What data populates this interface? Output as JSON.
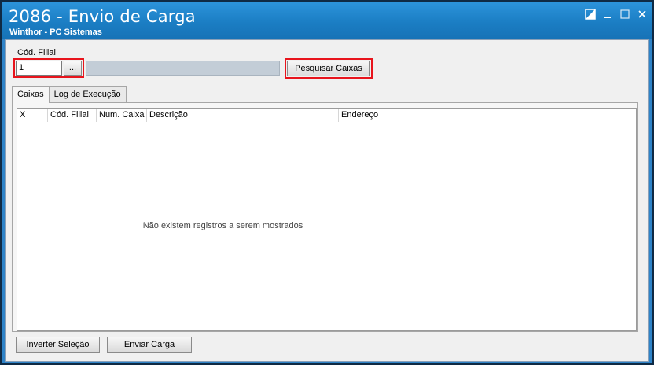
{
  "window": {
    "title": "2086 - Envio de Carga",
    "subtitle": "Winthor - PC Sistemas"
  },
  "filter": {
    "label": "Cód. Filial",
    "filial_value": "1",
    "lookup_label": "...",
    "search_button_label": "Pesquisar Caixas"
  },
  "tabs": [
    {
      "label": "Caixas",
      "active": true
    },
    {
      "label": "Log de Execução",
      "active": false
    }
  ],
  "grid": {
    "columns": [
      "X",
      "Cód. Filial",
      "Num. Caixa",
      "Descrição",
      "Endereço"
    ],
    "empty_message": "Não existem registros a serem mostrados"
  },
  "actions": {
    "invert_label": "Inverter Seleção",
    "send_label": "Enviar Carga"
  },
  "colors": {
    "titlebar": "#1b7ec4",
    "highlight": "#e8141c"
  }
}
